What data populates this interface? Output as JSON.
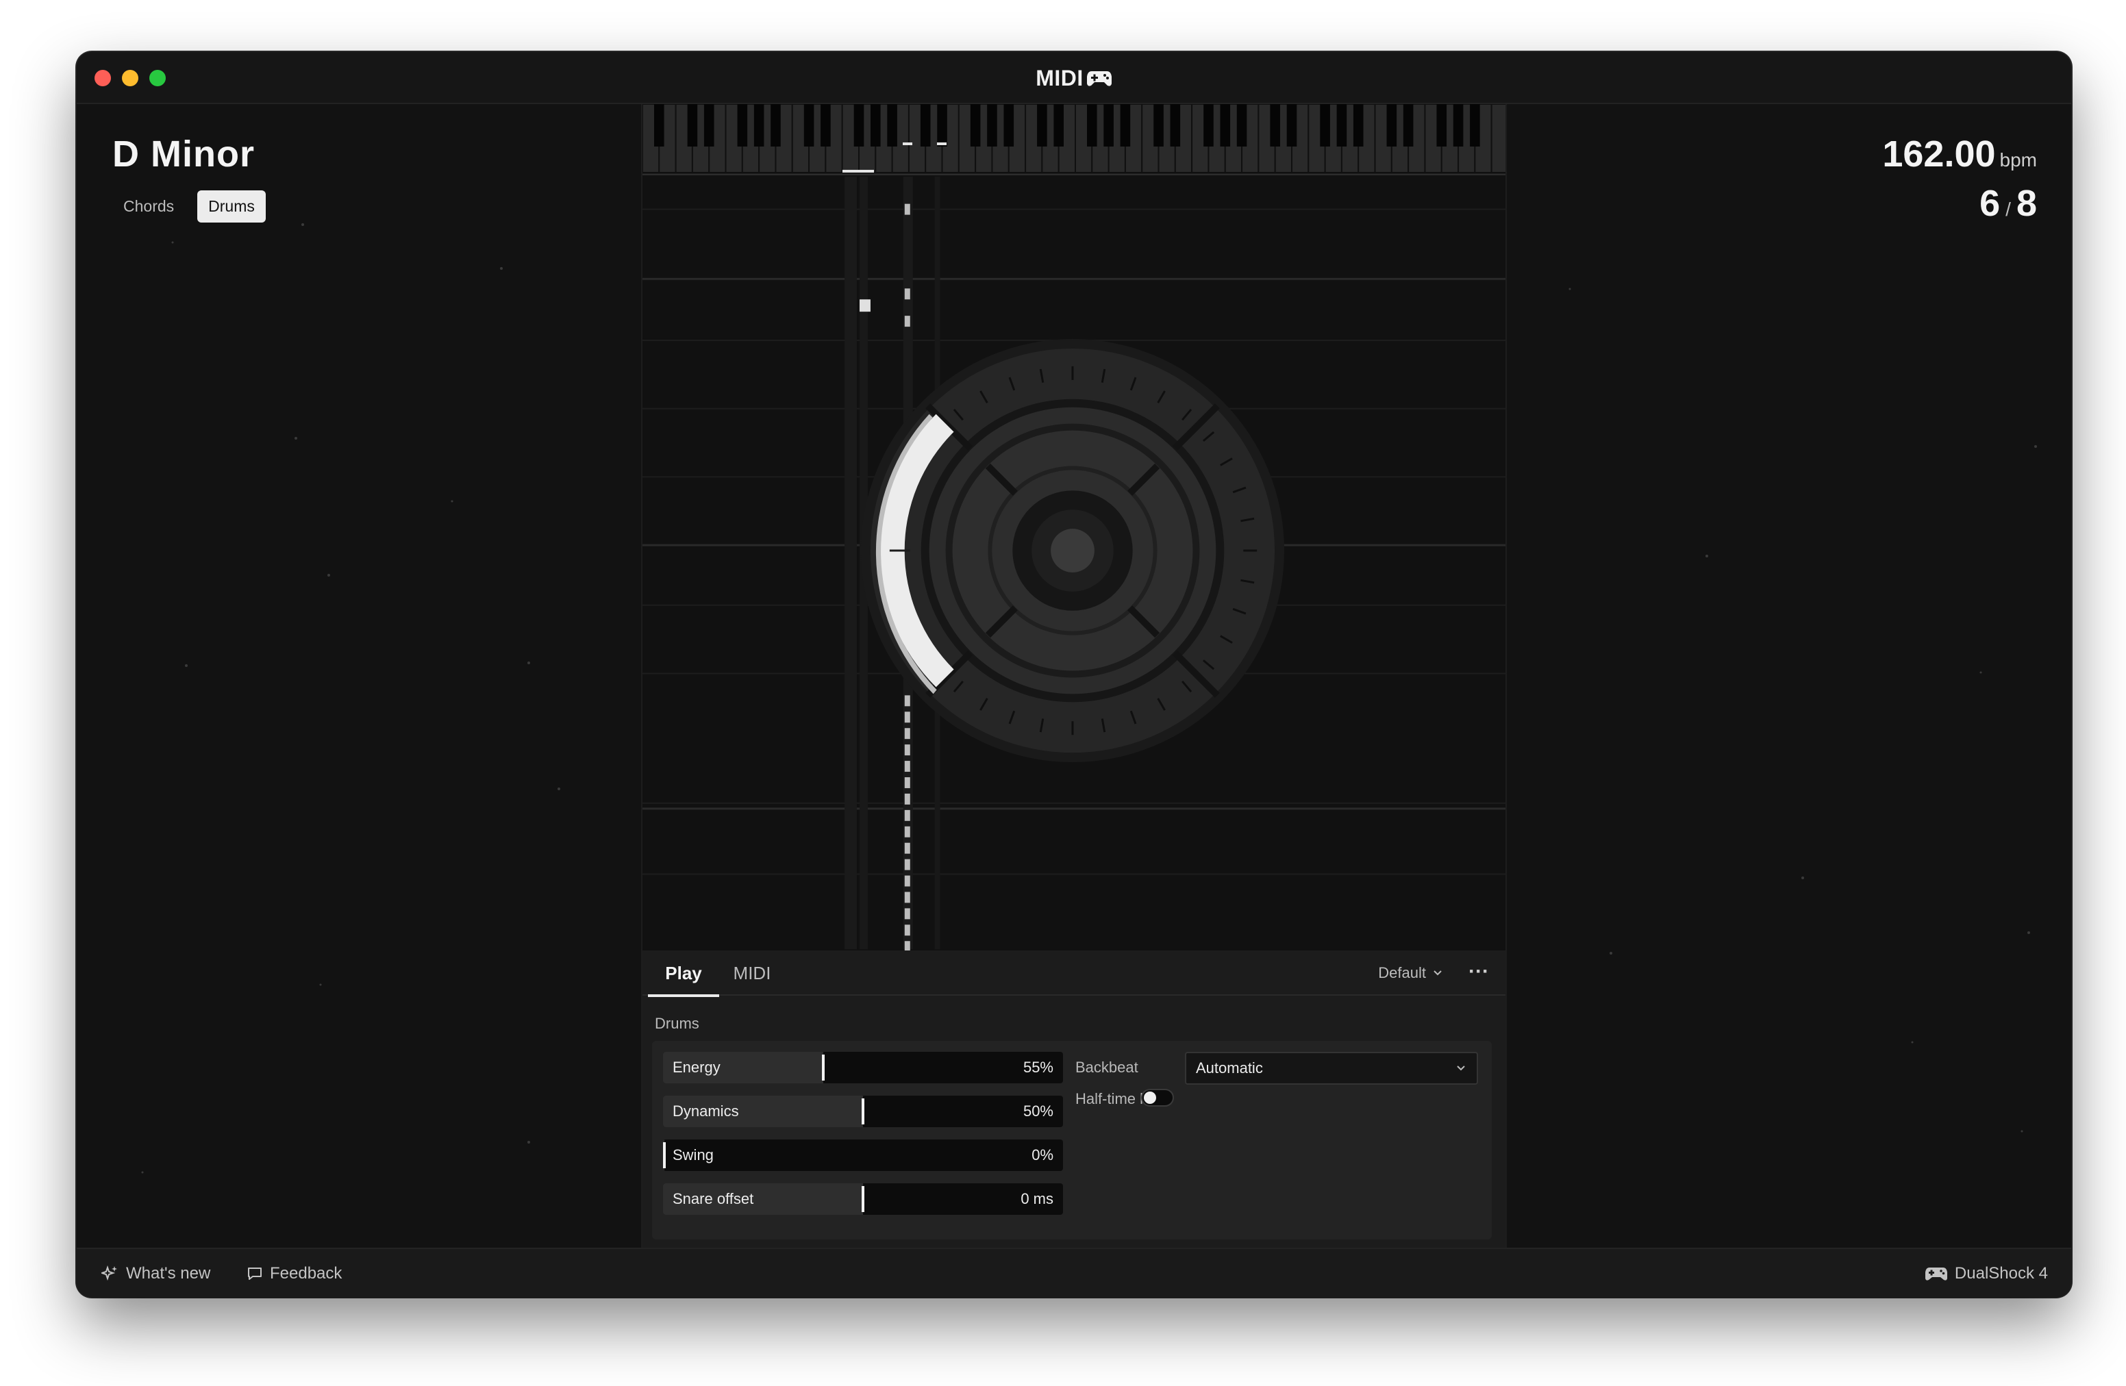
{
  "window": {
    "title": "MIDI"
  },
  "song": {
    "key": "D Minor",
    "modes": [
      {
        "label": "Chords",
        "active": false
      },
      {
        "label": "Drums",
        "active": true
      }
    ],
    "tempo": {
      "value": "162.00",
      "unit": "bpm"
    },
    "meter": {
      "numerator": "6",
      "separator": "/",
      "denominator": "8"
    }
  },
  "panel": {
    "tabs": [
      {
        "label": "Play",
        "active": true
      },
      {
        "label": "MIDI",
        "active": false
      }
    ],
    "preset": {
      "label": "Default"
    },
    "more_label": "···",
    "section": "Drums",
    "sliders": [
      {
        "label": "Energy",
        "value": "55%",
        "level": 0.4
      },
      {
        "label": "Dynamics",
        "value": "50%",
        "level": 0.5
      },
      {
        "label": "Swing",
        "value": "0%",
        "level": 0
      },
      {
        "label": "Snare offset",
        "value": "0 ms",
        "level": 0.5
      }
    ],
    "backbeat": {
      "label": "Backbeat",
      "value": "Automatic"
    },
    "half_time_lock": {
      "label": "Half-time lock",
      "on": false
    }
  },
  "statusbar": {
    "whats_new": "What's new",
    "feedback": "Feedback",
    "controller": "DualShock 4"
  },
  "colors": {
    "background": "#121212",
    "accent": "#ececec",
    "panel": "#1c1c1c"
  }
}
